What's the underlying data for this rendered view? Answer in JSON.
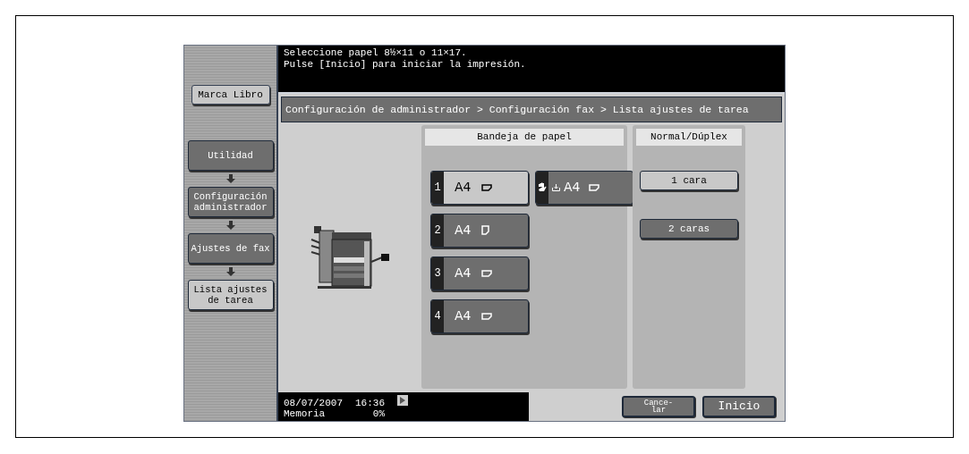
{
  "message": [
    "Seleccione papel 8½×11 o 11×17.",
    "Pulse [Inicio] para iniciar la impresión."
  ],
  "bookmark_button": {
    "label": "Marca Libro"
  },
  "breadcrumb": "Configuración de administrador > Configuración fax > Lista ajustes de tarea",
  "nav": [
    {
      "label": "Utilidad",
      "selected": false
    },
    {
      "label": "Configuración administrador",
      "selected": false
    },
    {
      "label": "Ajustes de fax",
      "selected": false
    },
    {
      "label": "Lista ajustes de tarea",
      "selected": true
    }
  ],
  "paper_tray": {
    "title": "Bandeja de papel",
    "trays": [
      {
        "kind": "numbered",
        "number": "1",
        "size": "A4",
        "paper_icon": {
          "kind": "landscape"
        },
        "selected": true
      },
      {
        "kind": "bypass",
        "size": "A4",
        "paper_icon": {
          "kind": "landscape"
        },
        "selected": false
      },
      {
        "kind": "numbered",
        "number": "2",
        "size": "A4",
        "paper_icon": {
          "kind": "portrait"
        },
        "selected": false
      },
      {
        "kind": "numbered",
        "number": "3",
        "size": "A4",
        "paper_icon": {
          "kind": "landscape"
        },
        "selected": false
      },
      {
        "kind": "numbered",
        "number": "4",
        "size": "A4",
        "paper_icon": {
          "kind": "landscape"
        },
        "selected": false
      }
    ]
  },
  "duplex": {
    "title": "Normal/Dúplex",
    "options": [
      {
        "label": "1 cara",
        "selected": true
      },
      {
        "label": "2 caras",
        "selected": false
      }
    ]
  },
  "status_bar": {
    "date": "08/07/2007",
    "time": "16:36",
    "memory_label": "Memoria",
    "memory": "0%"
  },
  "buttons": [
    "Cance-\nlar",
    "Inicio"
  ]
}
